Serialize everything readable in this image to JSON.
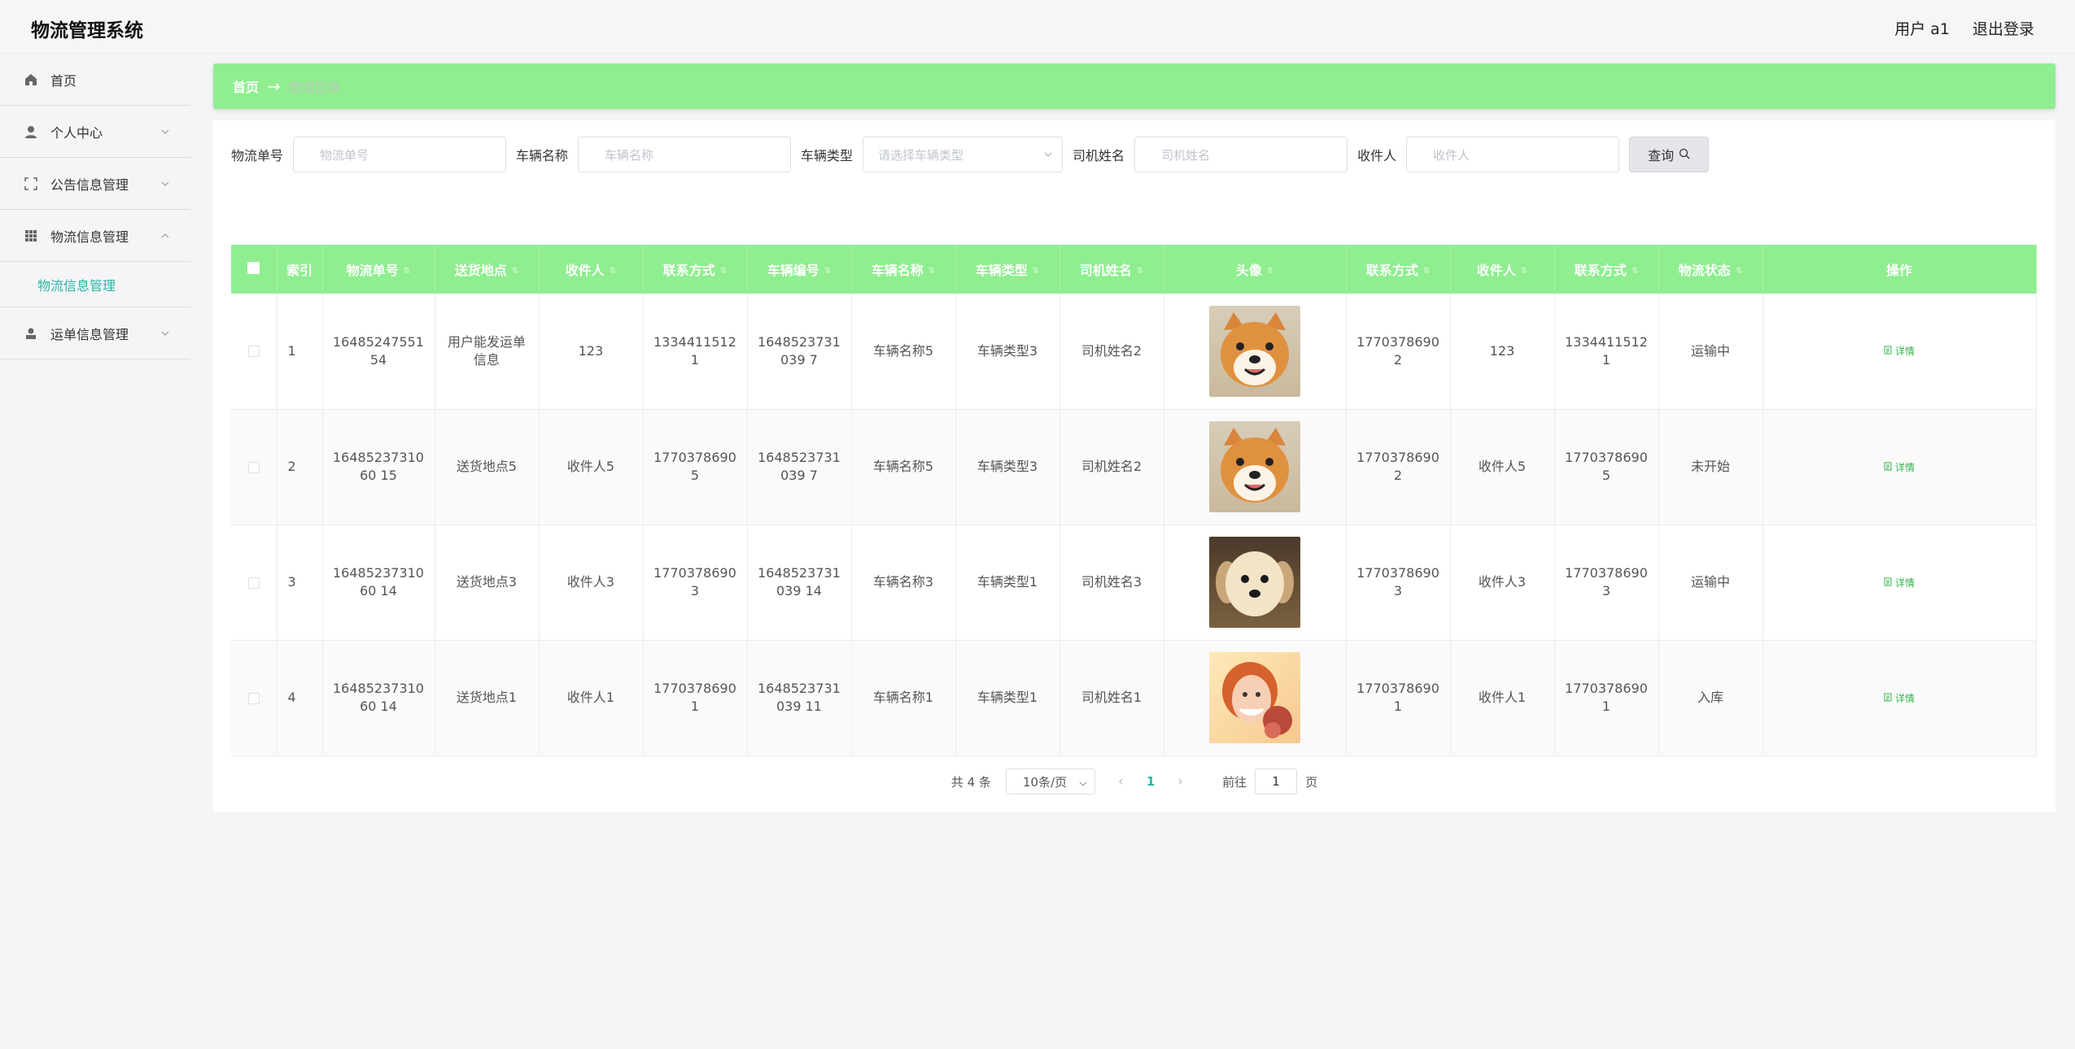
{
  "header": {
    "title": "物流管理系统",
    "user": "用户 a1",
    "logout": "退出登录"
  },
  "sidebar": {
    "items": [
      {
        "label": "首页"
      },
      {
        "label": "个人中心"
      },
      {
        "label": "公告信息管理"
      },
      {
        "label": "物流信息管理"
      },
      {
        "label": "运单信息管理"
      }
    ],
    "active_sub": "物流信息管理"
  },
  "breadcrumb": {
    "home": "首页",
    "current": "物流信息"
  },
  "search": {
    "f1_label": "物流单号",
    "f1_placeholder": "物流单号",
    "f2_label": "车辆名称",
    "f2_placeholder": "车辆名称",
    "f3_label": "车辆类型",
    "f3_placeholder": "请选择车辆类型",
    "f4_label": "司机姓名",
    "f4_placeholder": "司机姓名",
    "f5_label": "收件人",
    "f5_placeholder": "收件人",
    "button": "查询"
  },
  "table": {
    "headers": [
      "索引",
      "物流单号",
      "送货地点",
      "收件人",
      "联系方式",
      "车辆编号",
      "车辆名称",
      "车辆类型",
      "司机姓名",
      "头像",
      "联系方式",
      "收件人",
      "联系方式",
      "物流状态",
      "操作"
    ],
    "rows": [
      {
        "index": "1",
        "order": "1648524755154",
        "place": "用户能发运单信息",
        "receiver": "123",
        "phone": "13344115121",
        "vehicle_no": "1648523731039 7",
        "vehicle_name": "车辆名称5",
        "vehicle_type": "车辆类型3",
        "driver": "司机姓名2",
        "avatar": "shiba",
        "driver_phone": "17703786902",
        "receiver2": "123",
        "phone2": "13344115121",
        "status": "运输中",
        "action": "详情"
      },
      {
        "index": "2",
        "order": "1648523731060 15",
        "place": "送货地点5",
        "receiver": "收件人5",
        "phone": "17703786905",
        "vehicle_no": "1648523731039 7",
        "vehicle_name": "车辆名称5",
        "vehicle_type": "车辆类型3",
        "driver": "司机姓名2",
        "avatar": "shiba",
        "driver_phone": "17703786902",
        "receiver2": "收件人5",
        "phone2": "17703786905",
        "status": "未开始",
        "action": "详情"
      },
      {
        "index": "3",
        "order": "1648523731060 14",
        "place": "送货地点3",
        "receiver": "收件人3",
        "phone": "17703786903",
        "vehicle_no": "1648523731039 14",
        "vehicle_name": "车辆名称3",
        "vehicle_type": "车辆类型1",
        "driver": "司机姓名3",
        "avatar": "puppy",
        "driver_phone": "17703786903",
        "receiver2": "收件人3",
        "phone2": "17703786903",
        "status": "运输中",
        "action": "详情"
      },
      {
        "index": "4",
        "order": "1648523731060 14",
        "place": "送货地点1",
        "receiver": "收件人1",
        "phone": "17703786901",
        "vehicle_no": "1648523731039 11",
        "vehicle_name": "车辆名称1",
        "vehicle_type": "车辆类型1",
        "driver": "司机姓名1",
        "avatar": "woman",
        "driver_phone": "17703786901",
        "receiver2": "收件人1",
        "phone2": "17703786901",
        "status": "入库",
        "action": "详情"
      }
    ]
  },
  "pagination": {
    "total": "共 4 条",
    "page_size": "10条/页",
    "current": "1",
    "goto_prefix": "前往",
    "goto_value": "1",
    "goto_suffix": "页"
  },
  "colors": {
    "accent": "#8fee8f",
    "link": "#2ab3a6"
  }
}
